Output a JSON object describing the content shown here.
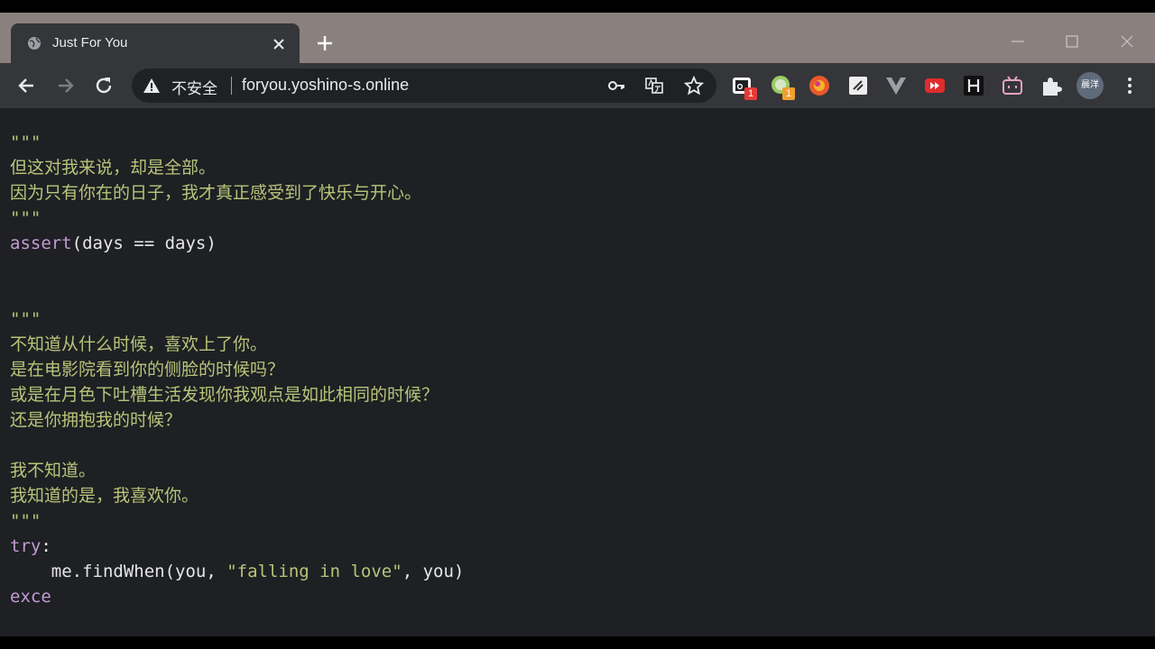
{
  "tab": {
    "title": "Just For You"
  },
  "omnibox": {
    "security_label": "不安全",
    "url": "foryou.yoshino-s.online"
  },
  "profile": {
    "avatar_text": "晨洋"
  },
  "extensions": [
    {
      "name": "ext-1-icon",
      "badge": "1",
      "badge_color": "#e53935"
    },
    {
      "name": "ext-2-icon",
      "badge": "1",
      "badge_color": "#f0a030"
    }
  ],
  "code_lines": [
    {
      "type": "comment",
      "text": "\"\"\""
    },
    {
      "type": "comment",
      "text": "但这对我来说，却是全部。"
    },
    {
      "type": "comment",
      "text": "因为只有你在的日子，我才真正感受到了快乐与开心。"
    },
    {
      "type": "comment",
      "text": "\"\"\""
    },
    {
      "type": "assert",
      "kw": "assert",
      "rest": "(days == days)"
    },
    {
      "type": "blank",
      "text": ""
    },
    {
      "type": "blank",
      "text": ""
    },
    {
      "type": "comment",
      "text": "\"\"\""
    },
    {
      "type": "comment",
      "text": "不知道从什么时候，喜欢上了你。"
    },
    {
      "type": "comment",
      "text": "是在电影院看到你的侧脸的时候吗？"
    },
    {
      "type": "comment",
      "text": "或是在月色下吐槽生活发现你我观点是如此相同的时候？"
    },
    {
      "type": "comment",
      "text": "还是你拥抱我的时候？"
    },
    {
      "type": "blank",
      "text": ""
    },
    {
      "type": "comment",
      "text": "我不知道。"
    },
    {
      "type": "comment",
      "text": "我知道的是，我喜欢你。"
    },
    {
      "type": "comment",
      "text": "\"\"\""
    },
    {
      "type": "try",
      "kw": "try",
      "rest": ":"
    },
    {
      "type": "call",
      "pre": "    me.findWhen(you, ",
      "str": "\"falling in love\"",
      "post": ", you)"
    },
    {
      "type": "keyword",
      "text": "exce"
    }
  ]
}
